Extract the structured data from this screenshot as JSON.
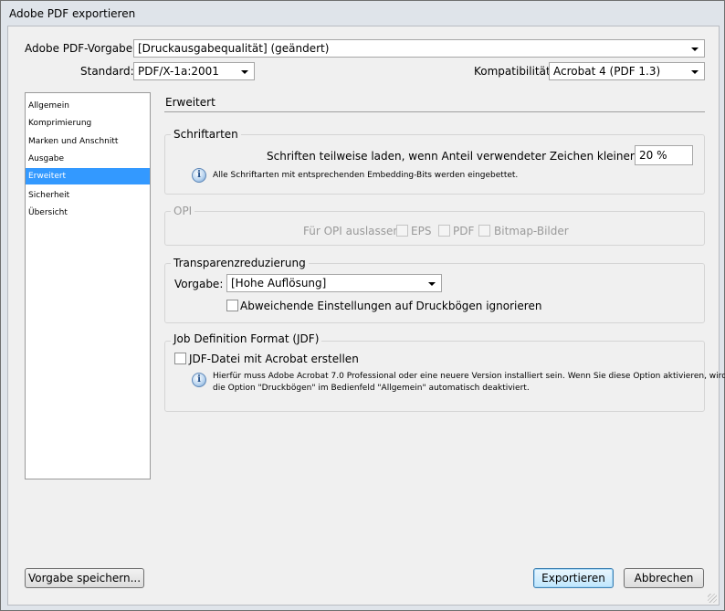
{
  "window": {
    "title": "Adobe PDF exportieren"
  },
  "preset": {
    "label": "Adobe PDF-Vorgabe:",
    "value": "[Druckausgabequalität] (geändert)"
  },
  "standard": {
    "label": "Standard:",
    "value": "PDF/X-1a:2001"
  },
  "compat": {
    "label": "Kompatibilität:",
    "value": "Acrobat 4 (PDF 1.3)"
  },
  "sidebar": {
    "items": [
      {
        "label": "Allgemein"
      },
      {
        "label": "Komprimierung"
      },
      {
        "label": "Marken und Anschnitt"
      },
      {
        "label": "Ausgabe"
      },
      {
        "label": "Erweitert"
      },
      {
        "label": "Sicherheit"
      },
      {
        "label": "Übersicht"
      }
    ],
    "selected_index": 4
  },
  "panel": {
    "title": "Erweitert"
  },
  "fonts": {
    "title": "Schriftarten",
    "subset_label": "Schriften teilweise laden, wenn Anteil verwendeter Zeichen kleiner ist als:",
    "subset_value": "20 %",
    "info": "Alle Schriftarten mit entsprechenden Embedding-Bits werden eingebettet."
  },
  "opi": {
    "title": "OPI",
    "omit_label": "Für OPI auslassen:",
    "eps": "EPS",
    "pdf": "PDF",
    "bitmap": "Bitmap-Bilder"
  },
  "transparency": {
    "title": "Transparenzreduzierung",
    "preset_label": "Vorgabe:",
    "preset_value": "[Hohe Auflösung]",
    "ignore_label": "Abweichende Einstellungen auf Druckbögen ignorieren"
  },
  "jdf": {
    "title": "Job Definition Format (JDF)",
    "create_label": "JDF-Datei mit Acrobat erstellen",
    "info_line1": "Hierfür muss Adobe Acrobat 7.0 Professional oder eine neuere Version installiert sein. Wenn Sie diese Option aktivieren, wird",
    "info_line2": "die Option \"Druckbögen\" im Bedienfeld \"Allgemein\" automatisch deaktiviert."
  },
  "buttons": {
    "save_preset": "Vorgabe speichern...",
    "export": "Exportieren",
    "cancel": "Abbrechen"
  }
}
